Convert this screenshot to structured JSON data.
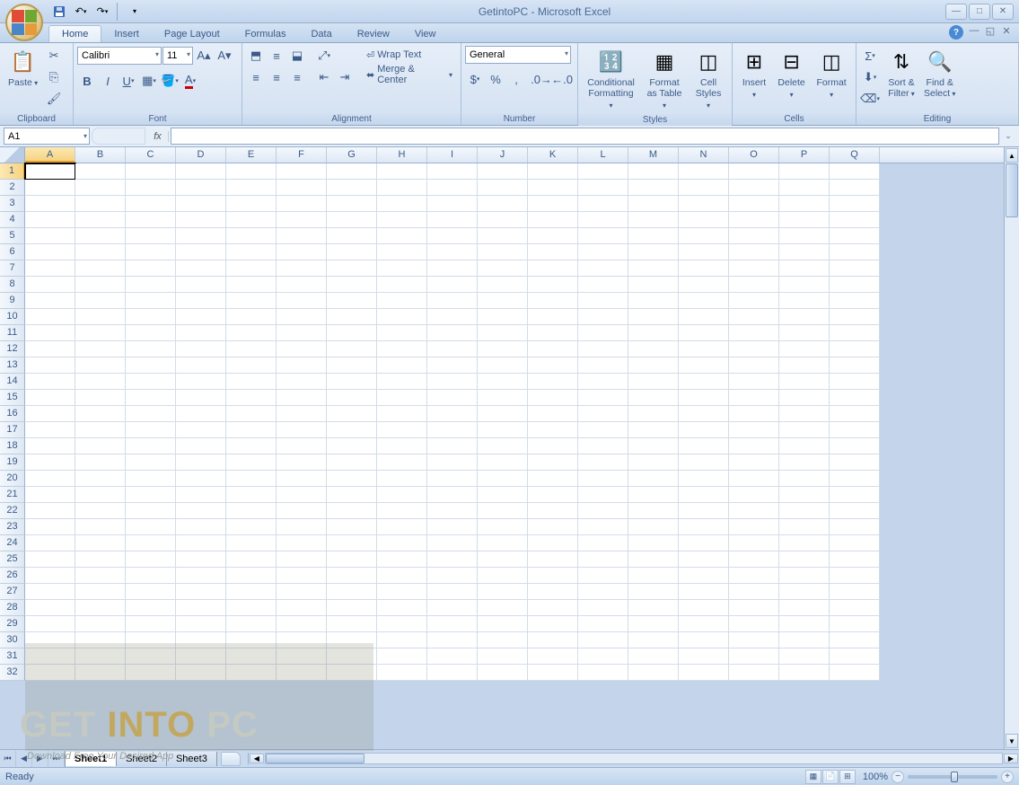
{
  "title": "GetintoPC - Microsoft Excel",
  "tabs": [
    "Home",
    "Insert",
    "Page Layout",
    "Formulas",
    "Data",
    "Review",
    "View"
  ],
  "active_tab": "Home",
  "groups": {
    "clipboard": {
      "label": "Clipboard",
      "paste": "Paste"
    },
    "font": {
      "label": "Font",
      "name": "Calibri",
      "size": "11"
    },
    "alignment": {
      "label": "Alignment",
      "wrap": "Wrap Text",
      "merge": "Merge & Center"
    },
    "number": {
      "label": "Number",
      "format": "General"
    },
    "styles": {
      "label": "Styles",
      "cond": "Conditional\nFormatting",
      "table": "Format\nas Table",
      "cell": "Cell\nStyles"
    },
    "cells": {
      "label": "Cells",
      "insert": "Insert",
      "delete": "Delete",
      "format": "Format"
    },
    "editing": {
      "label": "Editing",
      "sort": "Sort &\nFilter",
      "find": "Find &\nSelect"
    }
  },
  "name_box": "A1",
  "columns": [
    "A",
    "B",
    "C",
    "D",
    "E",
    "F",
    "G",
    "H",
    "I",
    "J",
    "K",
    "L",
    "M",
    "N",
    "O",
    "P",
    "Q"
  ],
  "row_count": 32,
  "active_cell": {
    "row": 1,
    "col": "A"
  },
  "sheets": [
    "Sheet1",
    "Sheet2",
    "Sheet3"
  ],
  "active_sheet": "Sheet1",
  "status": "Ready",
  "zoom": "100%",
  "watermark": {
    "w1": "GET",
    "w2": "INTO",
    "w3": "PC",
    "sub": "Download Free Your Desired App"
  }
}
